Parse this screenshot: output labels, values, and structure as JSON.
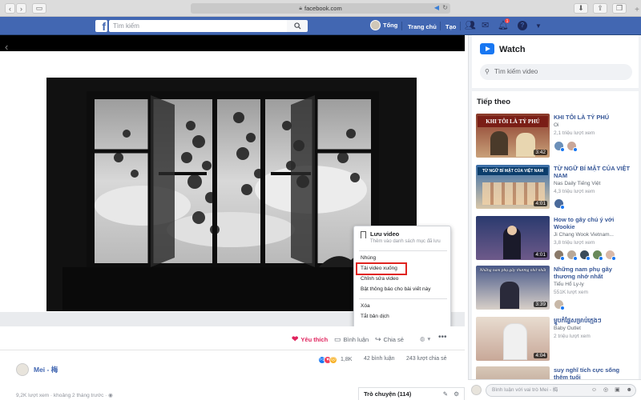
{
  "browser": {
    "url": "facebook.com"
  },
  "header": {
    "logo": "f",
    "search_placeholder": "Tìm kiếm",
    "user_name": "Tổng",
    "nav_home": "Trang chủ",
    "nav_create": "Tạo",
    "notification_count": "1",
    "help": "?"
  },
  "video": {
    "back_icon": "chevron-left-icon"
  },
  "context_menu": {
    "save_title": "Lưu video",
    "save_sub": "Thêm vào danh sách mục đã lưu",
    "items": [
      "Nhúng",
      "Tải video xuống",
      "Chỉnh sửa video",
      "Bật thông báo cho bài viết này",
      "Xóa",
      "Tắt bản dịch"
    ],
    "highlight_color": "#e0241f"
  },
  "actions": {
    "like": "Yêu thích",
    "comment": "Bình luận",
    "share": "Chia sẻ"
  },
  "stats": {
    "reactions": "1,8K",
    "comments": "42 bình luận",
    "shares": "243 lượt chia sẻ"
  },
  "page": {
    "name": "Mei - 梅",
    "meta": "9,2K lượt xem · khoảng 2 tháng trước ·"
  },
  "chat": {
    "label": "Trò chuyện (114)"
  },
  "watch": {
    "title": "Watch",
    "search_placeholder": "Tìm kiếm video",
    "up_next_title": "Tiếp theo",
    "videos": [
      {
        "title": "KHI TÔI LÀ TỶ PHÚ",
        "page": "Oi",
        "views": "2,1 triệu lượt xem",
        "duration": "3:42",
        "thumb_text": "KHI TÔI LÀ TỶ PHÚ"
      },
      {
        "title": "TỪ NGỮ BÍ MẬT CỦA VIỆT NAM",
        "page": "Nas Daily Tiếng Việt",
        "views": "4,3 triệu lượt xem",
        "duration": "4:01",
        "thumb_text": "TỪ NGỮ BÍ MẬT CỦA VIỆT NAM"
      },
      {
        "title": "How to gây chú ý với Wookie",
        "page": "Ji Chang Wook Vietnam...",
        "views": "3,8 triệu lượt xem",
        "duration": "4:01",
        "thumb_text": ""
      },
      {
        "title": "Những nam phụ gây thương nhớ nhất",
        "page": "Tiểu Hổ Ly-ly",
        "views": "551K lượt xem",
        "duration": "3:39",
        "thumb_text": "Những nam phụ gây thương nhớ nhất"
      },
      {
        "title": "ម្ហូបកំផ្លែសម្រាប់ក្មេងៗ",
        "page": "Baby Outlet",
        "views": "2 triệu lượt xem",
        "duration": "4:04",
        "thumb_text": ""
      },
      {
        "title": "suy nghĩ tích cực sống thêm tuổi",
        "page": "",
        "views": "",
        "duration": "",
        "thumb_text": ""
      }
    ]
  },
  "comment_bar": {
    "placeholder": "Bình luận với vai trò Mei - 梅"
  }
}
